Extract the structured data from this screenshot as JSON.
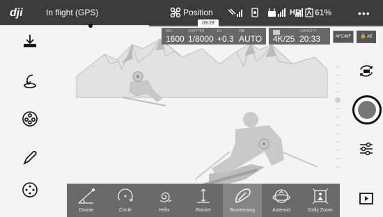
{
  "topbar": {
    "flight_status": "In flight (GPS)",
    "flight_mode": "Position",
    "rc_signal": "HD",
    "battery_percent": "61%",
    "menu": "•••",
    "recording_time": "09:29"
  },
  "camera": {
    "iso_label": "ISO",
    "iso_value": "1600",
    "shutter_label": "SHUTTER",
    "shutter_value": "1/8000",
    "ev_label": "EV",
    "ev_value": "+0.3",
    "wb_label": "WB",
    "wb_value": "AUTO",
    "resolution": "4K/25",
    "capacity_label": "CAPACITY",
    "capacity_value": "20:33",
    "focus_mode": "AFC/MF",
    "ae_lock": "AE"
  },
  "left_toolbar": [
    {
      "icon": "takeoff-icon"
    },
    {
      "icon": "return-home-icon"
    },
    {
      "icon": "intelligent-flight-icon"
    },
    {
      "icon": "draw-path-icon"
    },
    {
      "icon": "more-options-icon"
    }
  ],
  "right_toolbar": [
    {
      "icon": "camera-switch-icon"
    },
    {
      "icon": "shutter-button"
    },
    {
      "icon": "camera-settings-icon"
    },
    {
      "icon": "playback-icon"
    }
  ],
  "modes": [
    {
      "label": "Dronie",
      "icon": "dronie-icon",
      "active": false
    },
    {
      "label": "Circle",
      "icon": "circle-icon",
      "active": false
    },
    {
      "label": "Helix",
      "icon": "helix-icon",
      "active": false
    },
    {
      "label": "Rocket",
      "icon": "rocket-icon",
      "active": false
    },
    {
      "label": "Boomerang",
      "icon": "boomerang-icon",
      "active": true
    },
    {
      "label": "Asteroid",
      "icon": "asteroid-icon",
      "active": false
    },
    {
      "label": "Dolly Zoom",
      "icon": "dolly-zoom-icon",
      "active": false
    }
  ],
  "colors": {
    "topbar_bg": "#3b3b3b",
    "panel_bg": "#666666",
    "modebar_bg": "#6a6a6a",
    "active_mode_bg": "#858585",
    "shutter_fill": "#777777"
  }
}
